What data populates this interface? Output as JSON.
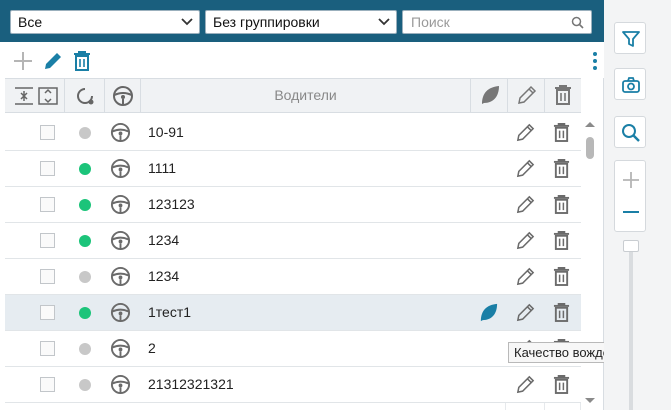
{
  "filters": {
    "status_select": "Все",
    "grouping_select": "Без группировки",
    "search_placeholder": "Поиск"
  },
  "table": {
    "header_drivers": "Водители",
    "rows": [
      {
        "name": "10-91",
        "status": "offline",
        "has_leaf": false
      },
      {
        "name": "1111",
        "status": "online",
        "has_leaf": false
      },
      {
        "name": "123123",
        "status": "online",
        "has_leaf": false
      },
      {
        "name": "1234",
        "status": "online",
        "has_leaf": false
      },
      {
        "name": "1234",
        "status": "offline",
        "has_leaf": false
      },
      {
        "name": "1тест1",
        "status": "online",
        "has_leaf": true,
        "selected": true
      },
      {
        "name": "2",
        "status": "offline",
        "has_leaf": false
      },
      {
        "name": "21312321321",
        "status": "offline",
        "has_leaf": false
      }
    ]
  },
  "tooltip": {
    "text": "Качество вождения"
  },
  "colors": {
    "header_bar": "#1a5f7e",
    "accent": "#1a7fa6",
    "online": "#1cc47a",
    "offline": "#c8c8c8",
    "icon_gray": "#6b6b6b"
  },
  "icons": {
    "toolbar": [
      "plus-icon",
      "pencil-icon",
      "trash-icon",
      "more-vertical-icon"
    ],
    "side": [
      "filter-icon",
      "camera-icon",
      "magnifier-icon",
      "zoom-in-icon",
      "zoom-out-icon"
    ]
  }
}
